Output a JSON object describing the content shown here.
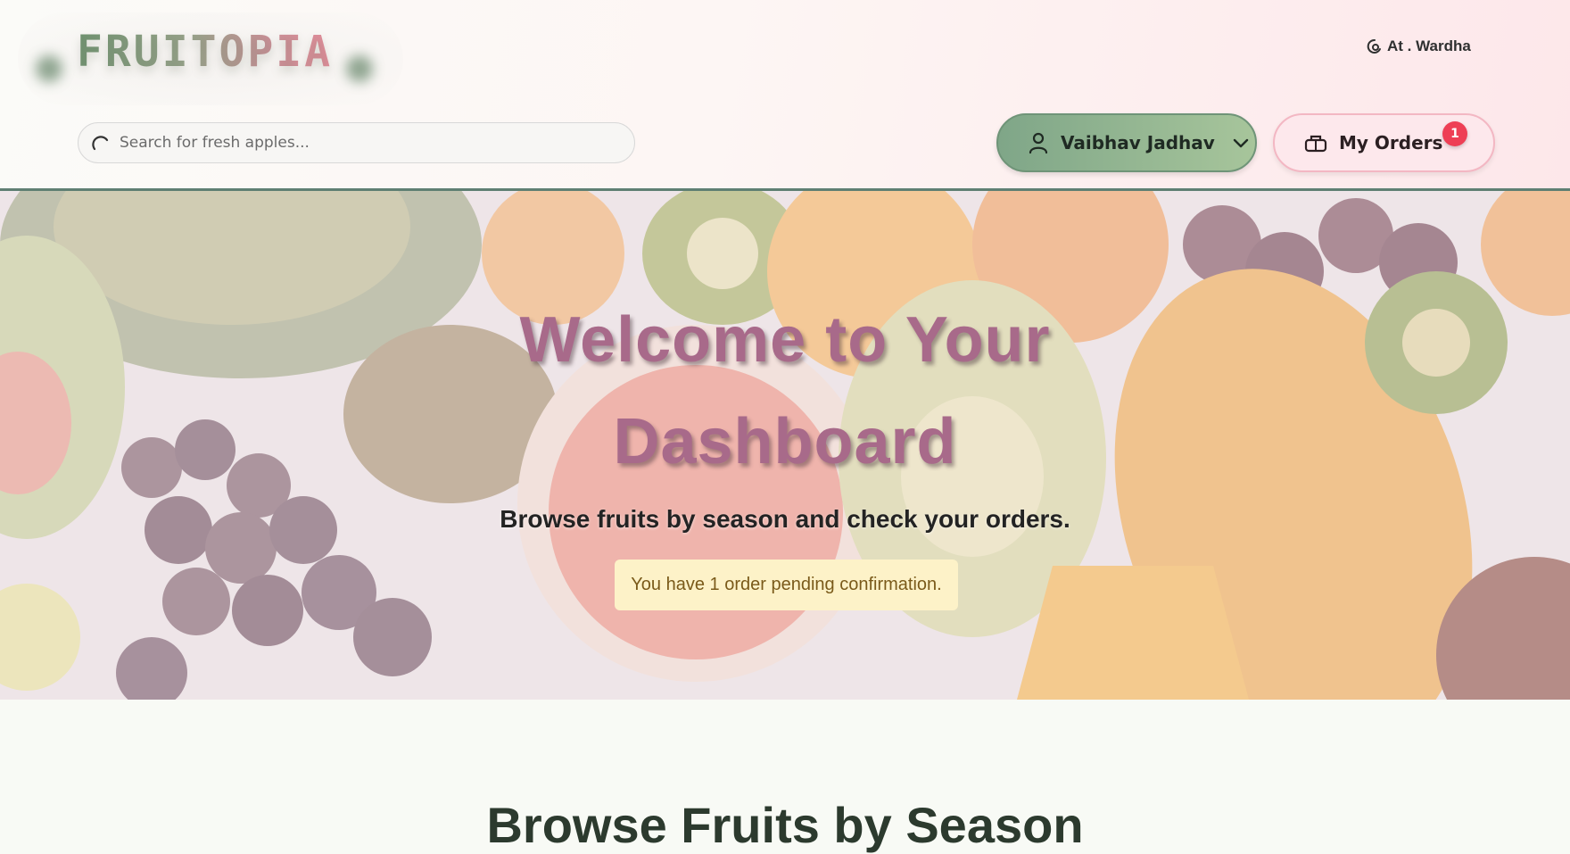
{
  "header": {
    "logo": "FRUITOPIA",
    "location": "At . Wardha",
    "search_placeholder": "Search for fresh apples...",
    "user_name": "Vaibhav Jadhav",
    "orders_label": "My Orders",
    "orders_count": "1"
  },
  "hero": {
    "title_line1": "Welcome to Your",
    "title_line2": "Dashboard",
    "subtitle": "Browse fruits by season and check your orders.",
    "notice": "You have 1 order pending confirmation."
  },
  "season": {
    "heading": "Browse Fruits by Season"
  },
  "colors": {
    "accent_green": "#7fa688",
    "accent_pink": "#fde8ec",
    "title_mauve": "#a86a8a",
    "badge_red": "#ee3f55",
    "notice_bg": "#fdf2c8"
  }
}
